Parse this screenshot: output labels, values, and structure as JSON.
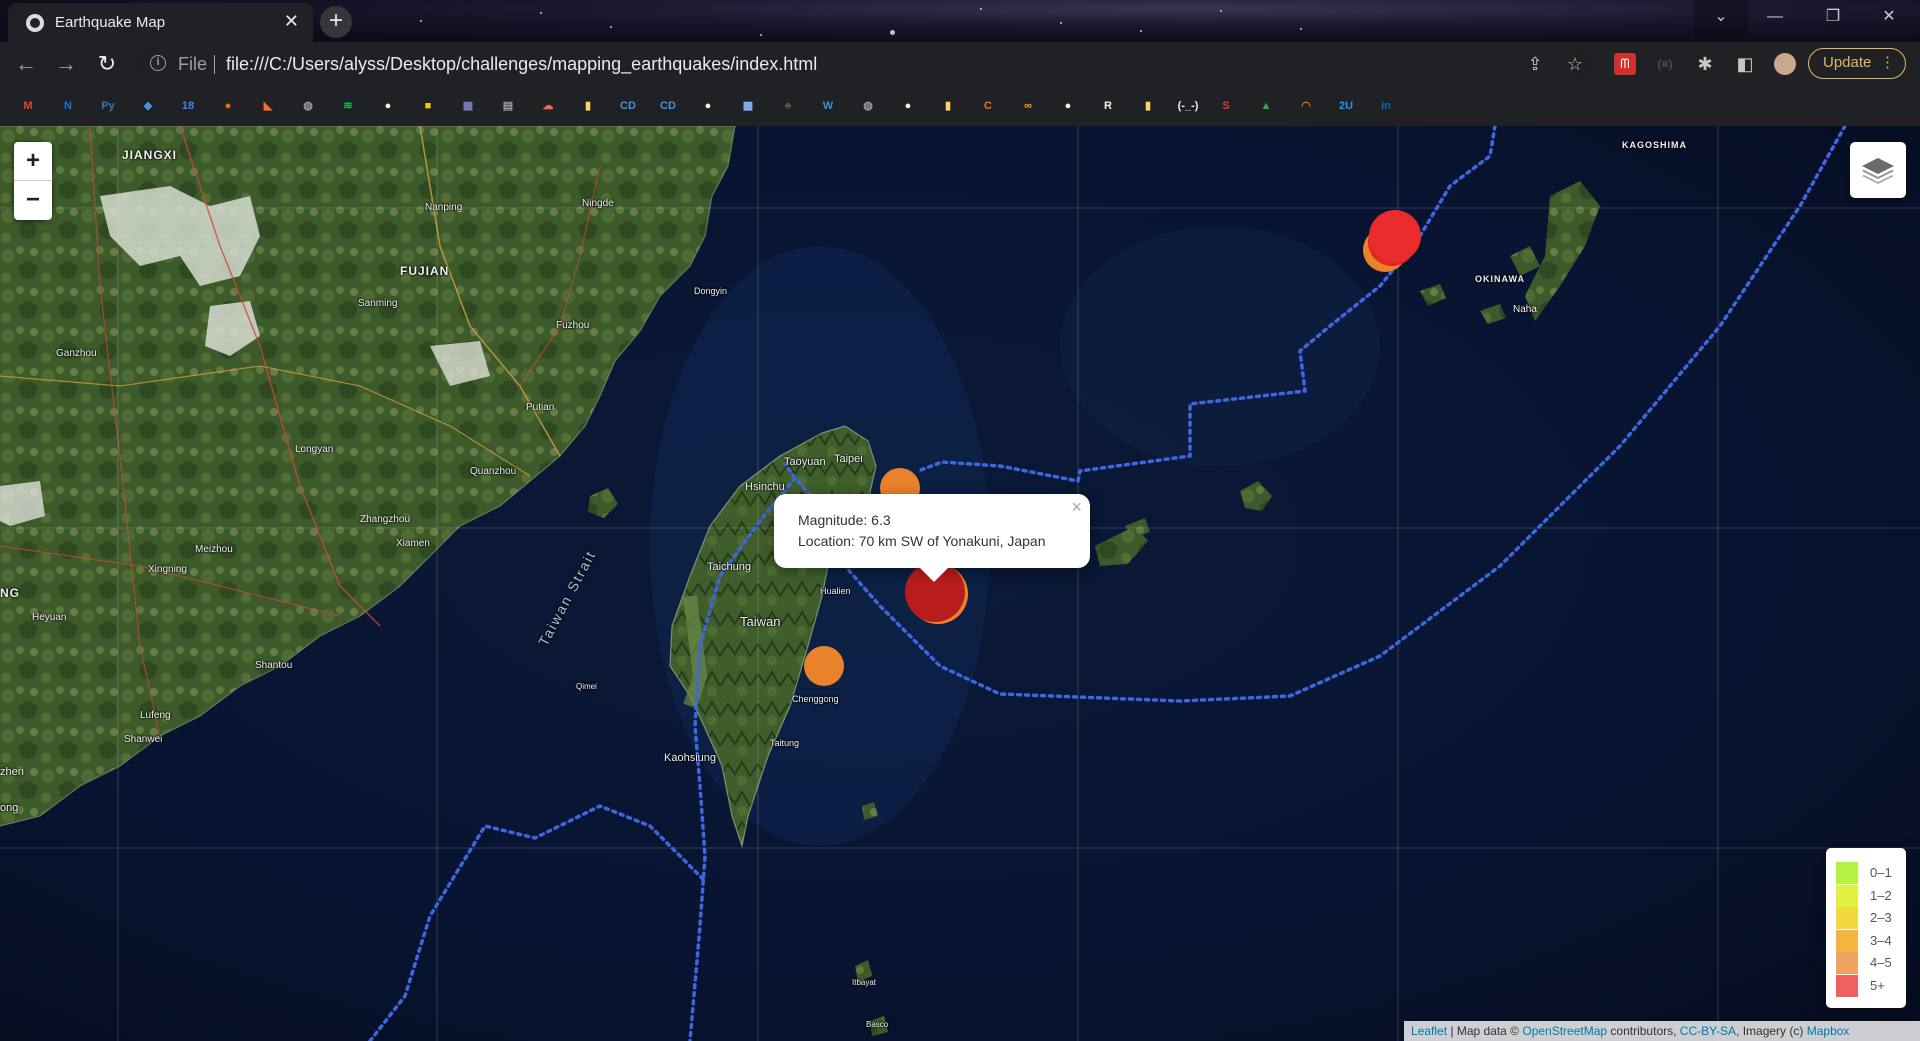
{
  "browser": {
    "tab_title": "Earthquake Map",
    "tab_close": "✕",
    "new_tab": "+",
    "scheme_label": "File",
    "url": "file:///C:/Users/alyss/Desktop/challenges/mapping_earthquakes/index.html",
    "update_label": "Update"
  },
  "bookmarks": [
    {
      "icon": "gmail-icon",
      "color": "#ea4335",
      "glyph": "M"
    },
    {
      "icon": "news-icon",
      "color": "#1a73e8",
      "glyph": "N"
    },
    {
      "icon": "python-icon",
      "color": "#3776ab",
      "glyph": "Py"
    },
    {
      "icon": "diamond-icon",
      "color": "#4a90e2",
      "glyph": "◆"
    },
    {
      "icon": "calendar-icon",
      "color": "#4285f4",
      "glyph": "18"
    },
    {
      "icon": "circle-orange-icon",
      "color": "#e8711c",
      "glyph": "●"
    },
    {
      "icon": "gitlab-icon",
      "color": "#fc6d26",
      "glyph": "◣"
    },
    {
      "icon": "globe-icon",
      "color": "#9aa0a6",
      "glyph": "◍"
    },
    {
      "icon": "spotify-icon",
      "color": "#1db954",
      "glyph": "≋"
    },
    {
      "icon": "github-icon",
      "color": "#f0f0f0",
      "glyph": "●"
    },
    {
      "icon": "badge-icon",
      "color": "#f5c518",
      "glyph": "■"
    },
    {
      "icon": "grid-icon",
      "color": "#7f7fbf",
      "glyph": "▦"
    },
    {
      "icon": "doc-icon",
      "color": "#9aa0a6",
      "glyph": "▤"
    },
    {
      "icon": "cloud-icon",
      "color": "#ef6c57",
      "glyph": "☁"
    },
    {
      "icon": "note-icon",
      "color": "#fdd663",
      "glyph": "▮"
    },
    {
      "icon": "cd-icon",
      "color": "#4a90e2",
      "glyph": "CD"
    },
    {
      "icon": "cd-icon",
      "color": "#4a90e2",
      "glyph": "CD"
    },
    {
      "icon": "github-icon",
      "color": "#f0f0f0",
      "glyph": "●"
    },
    {
      "icon": "image-icon",
      "color": "#8ab4f8",
      "glyph": "▩"
    },
    {
      "icon": "leaf-icon",
      "color": "#555",
      "glyph": "♣"
    },
    {
      "icon": "wordpress-icon",
      "color": "#3b8fd6",
      "glyph": "W"
    },
    {
      "icon": "globe-icon",
      "color": "#9aa0a6",
      "glyph": "◍"
    },
    {
      "icon": "github-icon",
      "color": "#f0f0f0",
      "glyph": "●"
    },
    {
      "icon": "note-icon",
      "color": "#fdd663",
      "glyph": "▮"
    },
    {
      "icon": "c-icon",
      "color": "#f37021",
      "glyph": "C"
    },
    {
      "icon": "infinity-icon",
      "color": "#f5a623",
      "glyph": "∞"
    },
    {
      "icon": "github-icon",
      "color": "#f0f0f0",
      "glyph": "●"
    },
    {
      "icon": "r-icon",
      "color": "#f0f0f0",
      "glyph": "R"
    },
    {
      "icon": "note-icon",
      "color": "#fdd663",
      "glyph": "▮"
    },
    {
      "icon": "text-face-icon",
      "color": "#e8eaed",
      "glyph": "(-_-)"
    },
    {
      "icon": "s-icon",
      "color": "#e53935",
      "glyph": "S"
    },
    {
      "icon": "drive-icon",
      "color": "#34a853",
      "glyph": "▲"
    },
    {
      "icon": "orbit-icon",
      "color": "#f57c00",
      "glyph": "◠"
    },
    {
      "icon": "two-u-icon",
      "color": "#2196f3",
      "glyph": "2U"
    },
    {
      "icon": "linkedin-icon",
      "color": "#0a66c2",
      "glyph": "in"
    }
  ],
  "map": {
    "zoom_in": "+",
    "zoom_out": "−",
    "labels": {
      "jiangxi": "JIANGXI",
      "fujian": "FUJIAN",
      "okinawa": "OKINAWA",
      "kagoshima": "KAGOSHIMA",
      "taiwan_strait": "Taiwan Strait",
      "taiwan": "Taiwan",
      "taipei": "Taipei",
      "taoyuan": "Taoyuan",
      "hsinchu": "Hsinchu",
      "taichung": "Taichung",
      "hualien": "Hualien",
      "kaohsiung": "Kaohsiung",
      "taitung": "Taitung",
      "chenggong": "Chenggong",
      "fuzhou": "Fuzhou",
      "putian": "Putian",
      "quanzhou": "Quanzhou",
      "zhangzhou": "Zhangzhou",
      "xiamen": "Xiamen",
      "longyan": "Longyan",
      "sanming": "Sanming",
      "nanping": "Nanping",
      "ningde": "Ningde",
      "meizhou": "Meizhou",
      "shantou": "Shantou",
      "lufeng": "Lufeng",
      "shanwei": "Shanwei",
      "heyuan": "Heyuan",
      "ganzhou": "Ganzhou",
      "xingning": "Xingning",
      "naha": "Naha",
      "dongyin": "Dongyin",
      "ng": "NG",
      "zhen": "zhen",
      "ong": "ong",
      "gimei": "Qimei",
      "itbayat": "Itbayat",
      "basco": "Basco"
    },
    "popup": {
      "close": "×",
      "magnitude": "Magnitude: 6.3",
      "location": "Location: 70 km SW of Yonakuni, Japan"
    },
    "earthquakes": [
      {
        "magnitude": 6.3,
        "location": "70 km SW of Yonakuni, Japan",
        "color": "#b81d1d"
      },
      {
        "magnitude": 5.0,
        "location": "",
        "color": "#ea2c2c"
      },
      {
        "magnitude": 4.0,
        "location": "",
        "color": "#ea822c"
      },
      {
        "magnitude": 4.0,
        "location": "",
        "color": "#ea822c"
      }
    ],
    "legend": [
      {
        "label": "0–1",
        "color": "#98ee00"
      },
      {
        "label": "1–2",
        "color": "#d4ee00"
      },
      {
        "label": "2–3",
        "color": "#eecc00"
      },
      {
        "label": "3–4",
        "color": "#ee9c00"
      },
      {
        "label": "4–5",
        "color": "#ea822c"
      },
      {
        "label": "5+",
        "color": "#ea2c2c"
      }
    ],
    "attribution": {
      "leaflet": "Leaflet",
      "map_data": " | Map data © ",
      "osm": "OpenStreetMap",
      "contributors": " contributors, ",
      "ccbysa": "CC-BY-SA",
      "imagery": ", Imagery (c) ",
      "mapbox": "Mapbox"
    }
  }
}
